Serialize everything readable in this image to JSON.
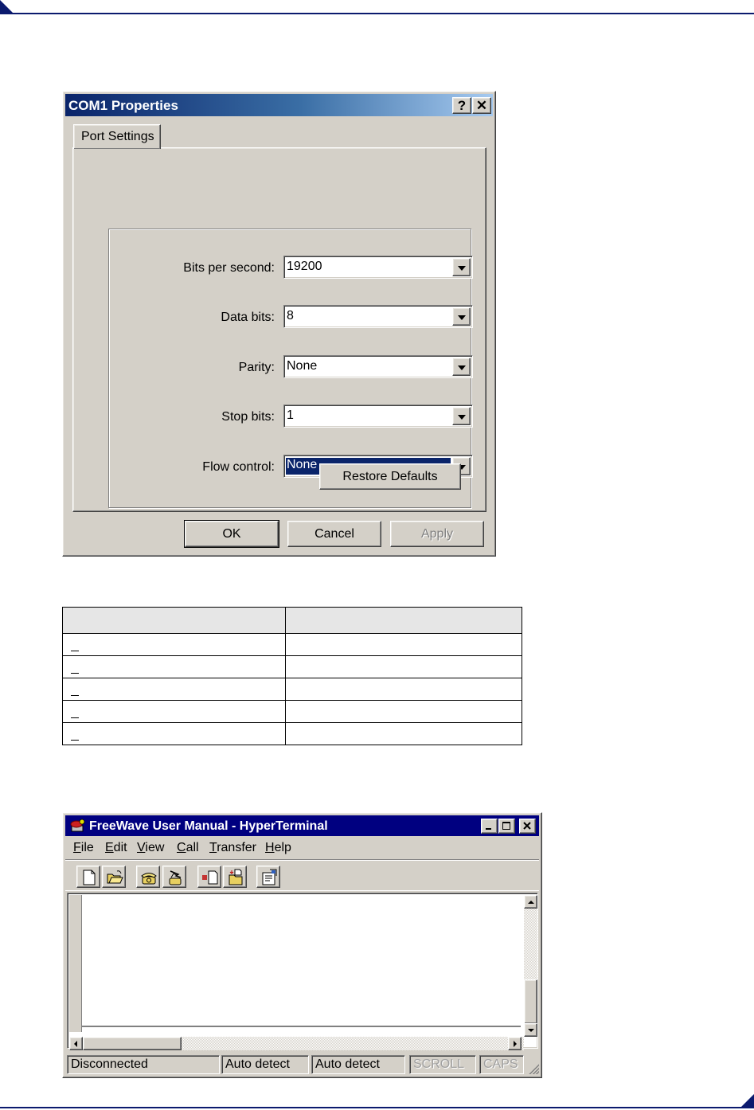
{
  "com1_dialog": {
    "title": "COM1 Properties",
    "help_glyph": "?",
    "close_glyph": "✕",
    "tab_label": "Port Settings",
    "fields": [
      {
        "label": "Bits per second:",
        "value": "19200"
      },
      {
        "label": "Data bits:",
        "value": "8"
      },
      {
        "label": "Parity:",
        "value": "None"
      },
      {
        "label": "Stop bits:",
        "value": "1"
      },
      {
        "label": "Flow control:",
        "value": "None"
      }
    ],
    "restore_defaults_label": "Restore Defaults",
    "ok_label": "OK",
    "cancel_label": "Cancel",
    "apply_label": "Apply",
    "title_gradient": [
      "#0a246a",
      "#a6caf0"
    ],
    "face_color": "#d4d0c8",
    "selection_color": "#0a246a"
  },
  "settings_table": {
    "rows": 5
  },
  "hyperterminal": {
    "title": "FreeWave User Manual - HyperTerminal",
    "menu": [
      {
        "accel": "F",
        "rest": "ile"
      },
      {
        "accel": "E",
        "rest": "dit"
      },
      {
        "accel": "V",
        "rest": "iew"
      },
      {
        "accel": "C",
        "rest": "all"
      },
      {
        "accel": "T",
        "rest": "ransfer"
      },
      {
        "accel": "H",
        "rest": "elp"
      }
    ],
    "toolbar_icons": [
      "new-icon",
      "open-folder-icon",
      "phone-call-icon",
      "disconnect-icon",
      "send-file-icon",
      "receive-file-icon",
      "properties-icon"
    ],
    "status": [
      "Disconnected",
      "Auto detect",
      "Auto detect",
      "SCROLL",
      "CAPS"
    ],
    "title_color": "#000080"
  }
}
